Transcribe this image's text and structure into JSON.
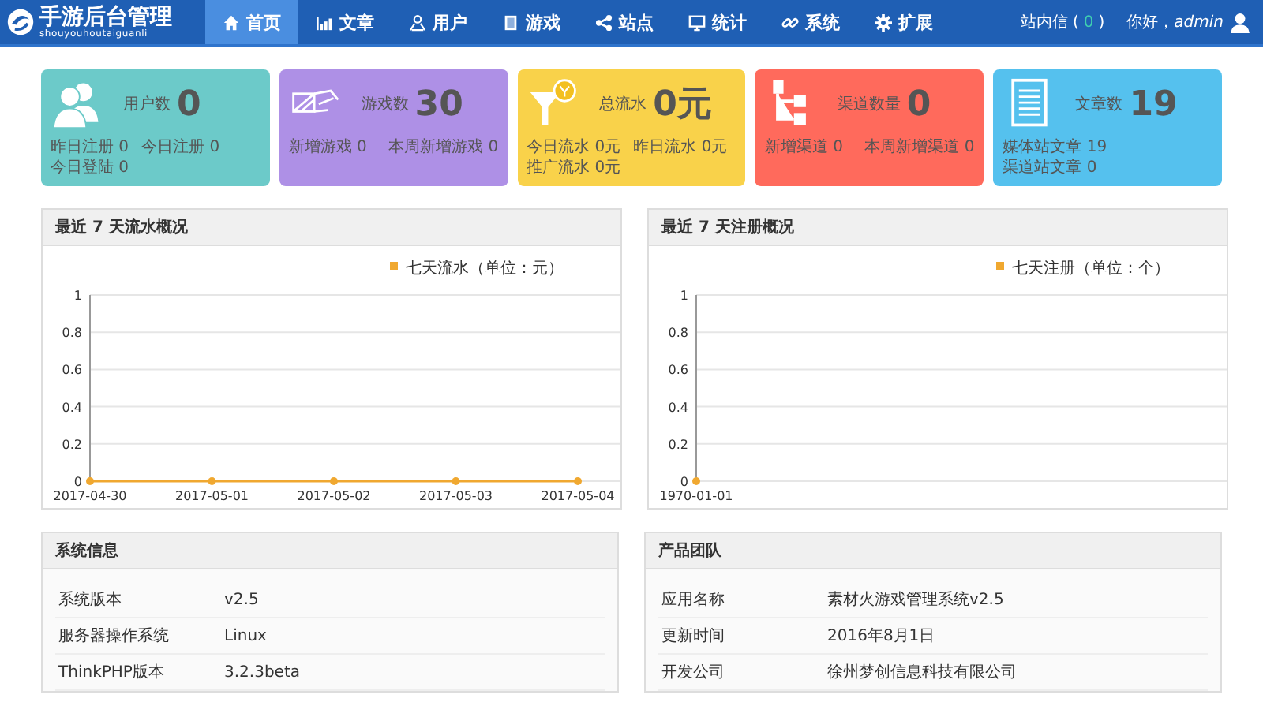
{
  "logo": {
    "title": "手游后台管理",
    "subtitle": "shouyouhoutaiguanli"
  },
  "nav": [
    {
      "label": "首页",
      "selected": true
    },
    {
      "label": "文章",
      "selected": false
    },
    {
      "label": "用户",
      "selected": false
    },
    {
      "label": "游戏",
      "selected": false
    },
    {
      "label": "站点",
      "selected": false
    },
    {
      "label": "统计",
      "selected": false
    },
    {
      "label": "系统",
      "selected": false
    },
    {
      "label": "扩展",
      "selected": false
    }
  ],
  "messages": {
    "label": "站内信 (",
    "count": "0",
    "close": ")"
  },
  "greeting": "你好，*admin*",
  "cards": [
    {
      "label": "用户数",
      "value": "0",
      "color": "#6ccac9",
      "stats": [
        "昨日注册 0",
        "今日注册 0",
        "今日登陆 0"
      ]
    },
    {
      "label": "游戏数",
      "value": "30",
      "color": "#ae90e6",
      "stats": [
        "新增游戏 0",
        "本周新增游戏 0"
      ]
    },
    {
      "label": "总流水",
      "value": "0元",
      "color": "#f9d24a",
      "stats": [
        "今日流水 0元",
        "昨日流水 0元",
        "推广流水 0元"
      ]
    },
    {
      "label": "渠道数量",
      "value": "0",
      "color": "#ff6a5c",
      "stats": [
        "新增渠道 0",
        "本周新增渠道 0"
      ]
    },
    {
      "label": "文章数",
      "value": "19",
      "color": "#55c1ee",
      "stats": [
        "媒体站文章 19",
        "渠道站文章 0"
      ]
    }
  ],
  "charts": [
    {
      "title": "最近 7 天流水概况",
      "chart_data": {
        "type": "line",
        "categories": [
          "2017-04-30",
          "2017-05-01",
          "2017-05-02",
          "2017-05-03",
          "2017-05-04"
        ],
        "ylim": [
          0,
          1
        ],
        "yticks": [
          0,
          0.2,
          0.4,
          0.6,
          0.8,
          1
        ],
        "grid": true,
        "series": [
          {
            "name": "七天流水（单位：元）",
            "color": "#f0a830",
            "marker": true,
            "values": [
              0,
              0,
              0,
              0,
              0
            ]
          }
        ]
      }
    },
    {
      "title": "最近 7 天注册概况",
      "chart_data": {
        "type": "line",
        "categories": [
          "1970-01-01"
        ],
        "ylim": [
          0,
          1
        ],
        "yticks": [
          0,
          0.2,
          0.4,
          0.6,
          0.8,
          1
        ],
        "grid": true,
        "series": [
          {
            "name": "七天注册（单位：个）",
            "color": "#f0a830",
            "marker": true,
            "values": [
              0
            ]
          }
        ]
      }
    }
  ],
  "info_panels": [
    {
      "title": "系统信息",
      "rows": [
        {
          "label": "系统版本",
          "value": "v2.5"
        },
        {
          "label": "服务器操作系统",
          "value": "Linux"
        },
        {
          "label": "ThinkPHP版本",
          "value": "3.2.3beta"
        }
      ]
    },
    {
      "title": "产品团队",
      "rows": [
        {
          "label": "应用名称",
          "value": "素材火游戏管理系统v2.5"
        },
        {
          "label": "更新时间",
          "value": "2016年8月1日"
        },
        {
          "label": "开发公司",
          "value": "徐州梦创信息科技有限公司"
        }
      ]
    }
  ]
}
